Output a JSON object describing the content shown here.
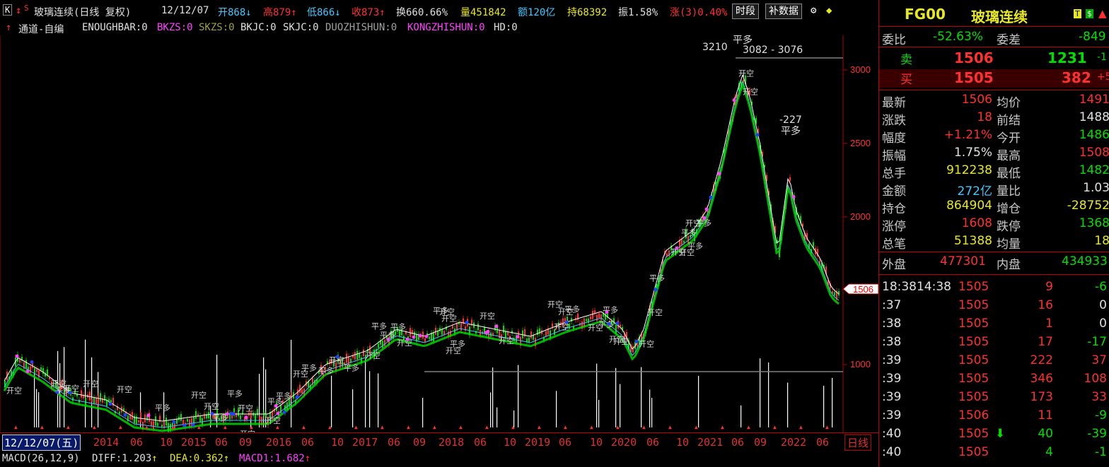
{
  "header": {
    "k_icon": "K",
    "s_icon": "S",
    "title": "玻璃连续(日线 复权)",
    "date": "12/12/07",
    "open_label": "开868",
    "high_label": "高879",
    "low_label": "低866",
    "close_label": "收873",
    "turnover": "换660.66%",
    "volume": "量451842",
    "amount": "额120亿",
    "hold": "持68392",
    "amplitude": "振1.58%",
    "change": "涨(3)0.40%",
    "btn_period": "时段",
    "btn_supplement": "补数据"
  },
  "indicator_bar": {
    "name": "通道-自编",
    "items": [
      {
        "text": "ENOUGHBAR:0",
        "color": "#e0e0e0"
      },
      {
        "text": "BKZS:0",
        "color": "#ff40ff"
      },
      {
        "text": "SKZS:0",
        "color": "#a0a040"
      },
      {
        "text": "BKJC:0",
        "color": "#e0e0e0"
      },
      {
        "text": "SKJC:0",
        "color": "#e0e0e0"
      },
      {
        "text": "DUOZHISHUN:0",
        "color": "#a0a0a0"
      },
      {
        "text": "KONGZHISHUN:0",
        "color": "#ff40ff"
      },
      {
        "text": "HD:0",
        "color": "#e0e0e0"
      }
    ]
  },
  "price_axis": {
    "ticks": [
      "3000",
      "2500",
      "2000",
      "1000"
    ],
    "current_tag": "1506",
    "max_label": "3210",
    "max_sub": "平多",
    "range_label": "3082 - 3076",
    "peak2": "-227",
    "peak2_sub": "平多"
  },
  "time_axis": {
    "cursor": "12/12/07(五)",
    "labels": [
      "2014",
      "06",
      "10",
      "2015",
      "06",
      "09",
      "2016",
      "06",
      "10",
      "2017",
      "06",
      "09",
      "2018",
      "06",
      "10",
      "2019",
      "06",
      "10",
      "2020",
      "06",
      "10",
      "2021",
      "06",
      "09",
      "2022",
      "06"
    ],
    "period": "日线"
  },
  "macd_bar": {
    "name": "MACD(26,12,9)",
    "diff": "DIFF:1.203",
    "dea": "DEA:0.362",
    "macd": "MACD1:1.682"
  },
  "quote": {
    "code": "FG00",
    "name": "玻璃连续",
    "weibi_label": "委比",
    "weibi": "-52.63%",
    "weicha_label": "委差",
    "weicha": "-849",
    "sell_label": "卖",
    "sell_price": "1506",
    "sell_vol": "1231",
    "sell_diff": "-1",
    "buy_label": "买",
    "buy_price": "1505",
    "buy_vol": "382",
    "buy_diff": "+5",
    "rows": [
      {
        "l1": "最新",
        "v1": "1506",
        "c1": "red",
        "l2": "均价",
        "v2": "1491",
        "c2": "red"
      },
      {
        "l1": "涨跌",
        "v1": "18",
        "c1": "red",
        "l2": "前结",
        "v2": "1488",
        "c2": "white"
      },
      {
        "l1": "幅度",
        "v1": "+1.21%",
        "c1": "red",
        "l2": "今开",
        "v2": "1486",
        "c2": "green"
      },
      {
        "l1": "振幅",
        "v1": "1.75%",
        "c1": "white",
        "l2": "最高",
        "v2": "1508",
        "c2": "red"
      },
      {
        "l1": "总手",
        "v1": "912238",
        "c1": "yellow",
        "l2": "最低",
        "v2": "1482",
        "c2": "green"
      },
      {
        "l1": "金额",
        "v1": "272亿",
        "c1": "cyan",
        "l2": "量比",
        "v2": "1.03",
        "c2": "white"
      },
      {
        "l1": "持仓",
        "v1": "864904",
        "c1": "yellow",
        "l2": "增仓",
        "v2": "-28752",
        "c2": "yellow"
      },
      {
        "l1": "涨停",
        "v1": "1608",
        "c1": "red",
        "l2": "跌停",
        "v2": "1368",
        "c2": "green"
      },
      {
        "l1": "总笔",
        "v1": "51388",
        "c1": "yellow",
        "l2": "均量",
        "v2": "18",
        "c2": "yellow"
      }
    ],
    "outer_label": "外盘",
    "outer": "477301",
    "inner_label": "内盘",
    "inner": "434933"
  },
  "ticks": [
    {
      "time": "18:3814:38",
      "price": "1505",
      "vol": "9",
      "chg": "-6",
      "cc": "green",
      "vc": "red"
    },
    {
      "time": ":37",
      "price": "1505",
      "vol": "16",
      "chg": "0",
      "cc": "white",
      "vc": "red"
    },
    {
      "time": ":38",
      "price": "1505",
      "vol": "1",
      "chg": "0",
      "cc": "white",
      "vc": "red"
    },
    {
      "time": ":38",
      "price": "1505",
      "vol": "17",
      "chg": "-17",
      "cc": "green",
      "vc": "red"
    },
    {
      "time": ":39",
      "price": "1505",
      "vol": "222",
      "chg": "37",
      "cc": "red",
      "vc": "red"
    },
    {
      "time": ":39",
      "price": "1505",
      "vol": "346",
      "chg": "108",
      "cc": "red",
      "vc": "red"
    },
    {
      "time": ":39",
      "price": "1505",
      "vol": "173",
      "chg": "33",
      "cc": "red",
      "vc": "red"
    },
    {
      "time": ":39",
      "price": "1506",
      "vol": "11",
      "chg": "-9",
      "cc": "green",
      "vc": "red"
    },
    {
      "time": ":40",
      "price": "1505",
      "vol": "40",
      "chg": "-39",
      "cc": "green",
      "vc": "green"
    },
    {
      "time": ":40",
      "price": "1505",
      "vol": "4",
      "chg": "-1",
      "cc": "green",
      "vc": "green"
    }
  ],
  "colors": {
    "up": "#ff3030",
    "down": "#00e000",
    "axis": "#b00000",
    "ma1": "#ffffff",
    "ma2": "#40c8ff"
  }
}
